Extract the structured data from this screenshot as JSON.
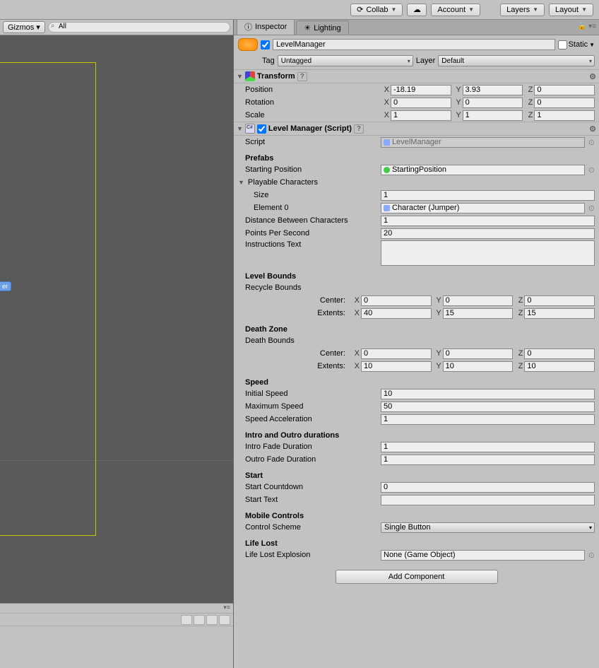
{
  "toolbar": {
    "collab": "Collab",
    "account": "Account",
    "layers": "Layers",
    "layout": "Layout"
  },
  "scene": {
    "gizmos": "Gizmos",
    "search_placeholder": "All",
    "tag_text": "er"
  },
  "tabs": {
    "inspector": "Inspector",
    "lighting": "Lighting"
  },
  "gameobject": {
    "name": "LevelManager",
    "static_label": "Static",
    "tag_label": "Tag",
    "tag_value": "Untagged",
    "layer_label": "Layer",
    "layer_value": "Default"
  },
  "transform": {
    "title": "Transform",
    "position_label": "Position",
    "position": {
      "x": "-18.19",
      "y": "3.93",
      "z": "0"
    },
    "rotation_label": "Rotation",
    "rotation": {
      "x": "0",
      "y": "0",
      "z": "0"
    },
    "scale_label": "Scale",
    "scale": {
      "x": "1",
      "y": "1",
      "z": "1"
    }
  },
  "levelmanager": {
    "title": "Level Manager (Script)",
    "script_label": "Script",
    "script_value": "LevelManager",
    "prefabs_header": "Prefabs",
    "starting_position_label": "Starting Position",
    "starting_position_value": "StartingPosition",
    "playable_characters_label": "Playable Characters",
    "size_label": "Size",
    "size_value": "1",
    "element0_label": "Element 0",
    "element0_value": "Character (Jumper)",
    "distance_label": "Distance Between Characters",
    "distance_value": "1",
    "points_label": "Points Per Second",
    "points_value": "20",
    "instructions_label": "Instructions Text",
    "level_bounds_header": "Level Bounds",
    "recycle_bounds_label": "Recycle Bounds",
    "center_label": "Center:",
    "extents_label": "Extents:",
    "recycle_center": {
      "x": "0",
      "y": "0",
      "z": "0"
    },
    "recycle_extents": {
      "x": "40",
      "y": "15",
      "z": "15"
    },
    "death_zone_header": "Death Zone",
    "death_bounds_label": "Death Bounds",
    "death_center": {
      "x": "0",
      "y": "0",
      "z": "0"
    },
    "death_extents": {
      "x": "10",
      "y": "10",
      "z": "10"
    },
    "speed_header": "Speed",
    "initial_speed_label": "Initial Speed",
    "initial_speed_value": "10",
    "max_speed_label": "Maximum Speed",
    "max_speed_value": "50",
    "speed_accel_label": "Speed Acceleration",
    "speed_accel_value": "1",
    "intro_outro_header": "Intro and Outro durations",
    "intro_fade_label": "Intro Fade Duration",
    "intro_fade_value": "1",
    "outro_fade_label": "Outro Fade Duration",
    "outro_fade_value": "1",
    "start_header": "Start",
    "start_countdown_label": "Start Countdown",
    "start_countdown_value": "0",
    "start_text_label": "Start Text",
    "start_text_value": "",
    "mobile_header": "Mobile Controls",
    "control_scheme_label": "Control Scheme",
    "control_scheme_value": "Single Button",
    "life_lost_header": "Life Lost",
    "life_lost_explosion_label": "Life Lost Explosion",
    "life_lost_explosion_value": "None (Game Object)"
  },
  "add_component": "Add Component"
}
